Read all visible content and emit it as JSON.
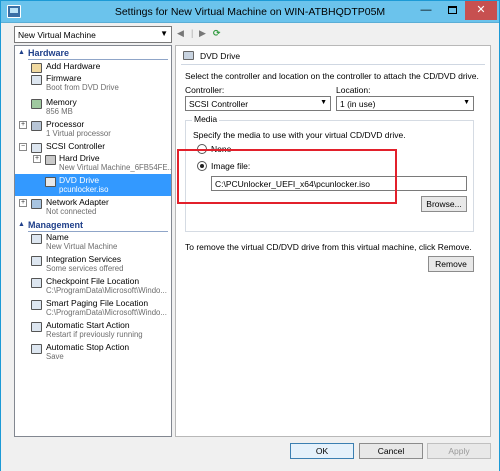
{
  "window": {
    "title": "Settings for New Virtual Machine on WIN-ATBHQDTP05M",
    "minimize": "—",
    "close": "✕"
  },
  "vm_selector": {
    "value": "New Virtual Machine",
    "arrow": "▼"
  },
  "tree": {
    "hardware_header": "Hardware",
    "management_header": "Management",
    "collapse_glyph": "▲",
    "hardware": [
      {
        "label": "Add Hardware",
        "sub": ""
      },
      {
        "label": "Firmware",
        "sub": "Boot from DVD Drive"
      },
      {
        "label": "Memory",
        "sub": "856 MB"
      },
      {
        "label": "Processor",
        "sub": "1 Virtual processor"
      },
      {
        "label": "SCSI Controller",
        "sub": ""
      },
      {
        "label": "Hard Drive",
        "sub": "New Virtual Machine_6FB54FE..."
      },
      {
        "label": "DVD Drive",
        "sub": "pcunlocker.iso"
      },
      {
        "label": "Network Adapter",
        "sub": "Not connected"
      }
    ],
    "management": [
      {
        "label": "Name",
        "sub": "New Virtual Machine"
      },
      {
        "label": "Integration Services",
        "sub": "Some services offered"
      },
      {
        "label": "Checkpoint File Location",
        "sub": "C:\\ProgramData\\Microsoft\\Windo..."
      },
      {
        "label": "Smart Paging File Location",
        "sub": "C:\\ProgramData\\Microsoft\\Windo..."
      },
      {
        "label": "Automatic Start Action",
        "sub": "Restart if previously running"
      },
      {
        "label": "Automatic Stop Action",
        "sub": "Save"
      }
    ]
  },
  "panel": {
    "title": "DVD Drive",
    "description": "Select the controller and location on the controller to attach the CD/DVD drive.",
    "controller_label": "Controller:",
    "controller_value": "SCSI Controller",
    "location_label": "Location:",
    "location_value": "1 (in use)",
    "media_legend": "Media",
    "media_desc": "Specify the media to use with your virtual CD/DVD drive.",
    "none_label": "None",
    "image_file_label": "Image file:",
    "image_path": "C:\\PCUnlocker_UEFI_x64\\pcunlocker.iso",
    "browse_button": "Browse...",
    "remove_text": "To remove the virtual CD/DVD drive from this virtual machine, click Remove.",
    "remove_button": "Remove"
  },
  "footer": {
    "ok": "OK",
    "cancel": "Cancel",
    "apply": "Apply"
  }
}
